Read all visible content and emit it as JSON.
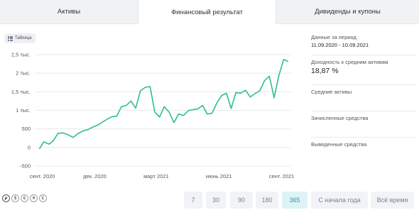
{
  "tabs": [
    {
      "label": "Активы"
    },
    {
      "label": "Финансовый результат"
    },
    {
      "label": "Дивиденды и купоны"
    }
  ],
  "table_toggle": {
    "label": "Таблица",
    "icon": "grid-icon"
  },
  "side": {
    "period_label": "Данные за период",
    "period_value": "11.09.2020 - 10.09.2021",
    "yield_label": "Доходность к средним активам",
    "yield_value": "18,87 %",
    "avg_assets_label": "Средние активы",
    "credited_label": "Зачисленные средства",
    "withdrawn_label": "Выведенные средства"
  },
  "currencies": [
    "₽",
    "$",
    "€",
    "¥",
    "£"
  ],
  "periods": [
    {
      "label": "7"
    },
    {
      "label": "30"
    },
    {
      "label": "90"
    },
    {
      "label": "180"
    },
    {
      "label": "365",
      "active": true
    },
    {
      "label": "С начала года"
    },
    {
      "label": "Всё время"
    }
  ],
  "colors": {
    "line": "#2fbf8a",
    "grid": "#e6e8ec",
    "active_period": "#2a9bb0"
  },
  "chart_data": {
    "type": "line",
    "ylim": [
      -500,
      2500
    ],
    "yticks": [
      -500,
      0,
      500,
      1000,
      1500,
      2000,
      2500
    ],
    "ytick_labels": [
      "-500",
      "0",
      "500",
      "1 тыс.",
      "1,5 тыс.",
      "2 тыс.",
      "2,5 тыс."
    ],
    "xticks": [
      {
        "label": "сент. 2020",
        "x": "2020-09-15"
      },
      {
        "label": "дек. 2020",
        "x": "2020-12-01"
      },
      {
        "label": "март 2021",
        "x": "2021-03-01"
      },
      {
        "label": "июнь 2021",
        "x": "2021-06-01"
      },
      {
        "label": "сент. 2021",
        "x": "2021-09-01"
      }
    ],
    "xlim": [
      "2020-09-05",
      "2021-09-15"
    ],
    "series": [
      {
        "points": [
          {
            "x": "2020-09-11",
            "y": -30
          },
          {
            "x": "2020-09-17",
            "y": 150
          },
          {
            "x": "2020-09-25",
            "y": 90
          },
          {
            "x": "2020-10-01",
            "y": 180
          },
          {
            "x": "2020-10-08",
            "y": 380
          },
          {
            "x": "2020-10-15",
            "y": 390
          },
          {
            "x": "2020-10-23",
            "y": 340
          },
          {
            "x": "2020-10-30",
            "y": 270
          },
          {
            "x": "2020-11-06",
            "y": 370
          },
          {
            "x": "2020-11-14",
            "y": 450
          },
          {
            "x": "2020-11-21",
            "y": 480
          },
          {
            "x": "2020-11-28",
            "y": 550
          },
          {
            "x": "2020-12-05",
            "y": 600
          },
          {
            "x": "2020-12-12",
            "y": 680
          },
          {
            "x": "2020-12-19",
            "y": 760
          },
          {
            "x": "2020-12-26",
            "y": 830
          },
          {
            "x": "2021-01-02",
            "y": 840
          },
          {
            "x": "2021-01-09",
            "y": 1100
          },
          {
            "x": "2021-01-16",
            "y": 1130
          },
          {
            "x": "2021-01-23",
            "y": 1250
          },
          {
            "x": "2021-01-30",
            "y": 1060
          },
          {
            "x": "2021-02-06",
            "y": 1530
          },
          {
            "x": "2021-02-13",
            "y": 1620
          },
          {
            "x": "2021-02-20",
            "y": 1640
          },
          {
            "x": "2021-02-27",
            "y": 950
          },
          {
            "x": "2021-03-06",
            "y": 820
          },
          {
            "x": "2021-03-13",
            "y": 1100
          },
          {
            "x": "2021-03-20",
            "y": 950
          },
          {
            "x": "2021-03-27",
            "y": 670
          },
          {
            "x": "2021-04-03",
            "y": 900
          },
          {
            "x": "2021-04-10",
            "y": 860
          },
          {
            "x": "2021-04-17",
            "y": 990
          },
          {
            "x": "2021-04-24",
            "y": 1020
          },
          {
            "x": "2021-05-01",
            "y": 1040
          },
          {
            "x": "2021-05-08",
            "y": 1130
          },
          {
            "x": "2021-05-15",
            "y": 900
          },
          {
            "x": "2021-05-22",
            "y": 920
          },
          {
            "x": "2021-05-29",
            "y": 1200
          },
          {
            "x": "2021-06-05",
            "y": 1400
          },
          {
            "x": "2021-06-12",
            "y": 1460
          },
          {
            "x": "2021-06-19",
            "y": 1050
          },
          {
            "x": "2021-06-26",
            "y": 1480
          },
          {
            "x": "2021-07-03",
            "y": 1460
          },
          {
            "x": "2021-07-10",
            "y": 1540
          },
          {
            "x": "2021-07-17",
            "y": 1360
          },
          {
            "x": "2021-07-24",
            "y": 1450
          },
          {
            "x": "2021-07-31",
            "y": 1530
          },
          {
            "x": "2021-08-07",
            "y": 1800
          },
          {
            "x": "2021-08-14",
            "y": 1920
          },
          {
            "x": "2021-08-21",
            "y": 1340
          },
          {
            "x": "2021-08-28",
            "y": 1940
          },
          {
            "x": "2021-09-04",
            "y": 2370
          },
          {
            "x": "2021-09-10",
            "y": 2320
          }
        ]
      }
    ],
    "grid": true
  }
}
